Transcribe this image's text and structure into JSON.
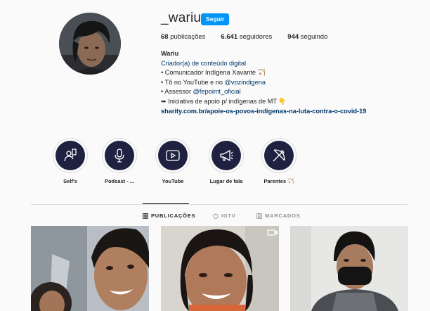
{
  "profile": {
    "username": "_wariu",
    "follow_label": "Seguir",
    "stats": {
      "posts_count": "68",
      "posts_label": "publicações",
      "followers_count": "6.641",
      "followers_label": "seguidores",
      "following_count": "944",
      "following_label": "seguindo"
    },
    "bio": {
      "name": "Wariu",
      "category": "Criador(a) de conteúdo digital",
      "line1": "• Comunicador Indígena Xavante 🏹",
      "line2_prefix": "• Tô no YouTube e no ",
      "line2_handle": "@vozindigena",
      "line3_prefix": "• Assessor ",
      "line3_handle": "@fepoimt_oficial",
      "line4": "➥ Iniciativa de apoio p/ indígenas de MT 👇",
      "website": "sharity.com.br/apoie-os-povos-indigenas-na-luta-contra-o-covid-19"
    }
  },
  "highlights": [
    {
      "label": "Self's",
      "icon": "selfie-icon"
    },
    {
      "label": "Podcast - ...",
      "icon": "microphone-icon"
    },
    {
      "label": "YouTube",
      "icon": "play-icon"
    },
    {
      "label": "Lugar de fala",
      "icon": "megaphone-icon"
    },
    {
      "label": "Parentes 🏹",
      "icon": "bow-arrow-icon"
    }
  ],
  "tabs": [
    {
      "label": "PUBLICAÇÕES",
      "icon": "grid-icon",
      "active": true
    },
    {
      "label": "IGTV",
      "icon": "igtv-icon",
      "active": false
    },
    {
      "label": "MARCADOS",
      "icon": "tagged-icon",
      "active": false
    }
  ],
  "colors": {
    "accent": "#0095f6",
    "link": "#00376b",
    "highlight_disc": "#1e2240",
    "background": "#fafafa"
  }
}
